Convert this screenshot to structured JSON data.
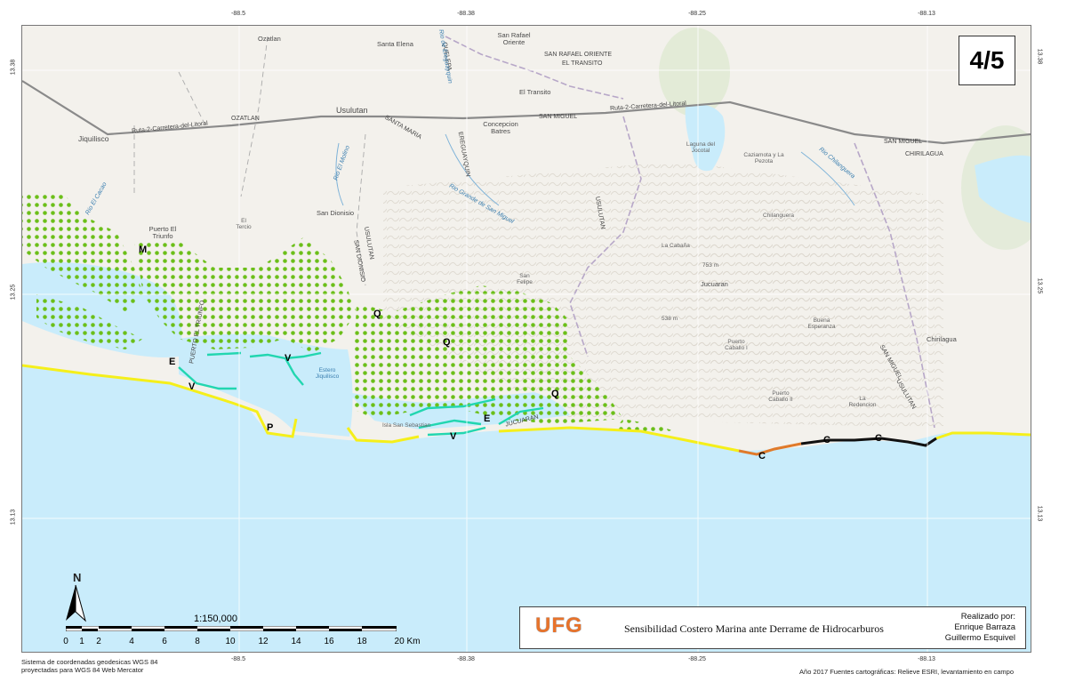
{
  "page_number": "4/5",
  "coordinates": {
    "top": [
      "-88.5",
      "-88.38",
      "-88.25",
      "-88.13"
    ],
    "bottom": [
      "-88.5",
      "-88.38",
      "-88.25",
      "-88.13"
    ],
    "left": [
      "13.38",
      "13.25",
      "13.13"
    ],
    "right": [
      "13.38",
      "13.25",
      "13.13"
    ]
  },
  "places": [
    {
      "name": "Ozatlan"
    },
    {
      "name": "Santa Elena"
    },
    {
      "name": "San Rafael Oriente"
    },
    {
      "name": "El Transito"
    },
    {
      "name": "Usulutan"
    },
    {
      "name": "Jiquilisco"
    },
    {
      "name": "Concepcion Batres"
    },
    {
      "name": "Laguna del Jocotal"
    },
    {
      "name": "Caziamota y La Pezota"
    },
    {
      "name": "Puerto El Triunfo"
    },
    {
      "name": "San Dionisio"
    },
    {
      "name": "El Tercio"
    },
    {
      "name": "Chilanguera"
    },
    {
      "name": "La Cabaña"
    },
    {
      "name": "Jucuaran"
    },
    {
      "name": "San Felipe"
    },
    {
      "name": "Buena Esperanza"
    },
    {
      "name": "Chirilagua"
    },
    {
      "name": "Puerto Caballo I"
    },
    {
      "name": "Puerto Caballo II"
    },
    {
      "name": "La Redencion"
    },
    {
      "name": "Estero Jiquilisco"
    },
    {
      "name": "Isla San Sebastian"
    },
    {
      "name": "753 m"
    },
    {
      "name": "538 m"
    }
  ],
  "roads": [
    {
      "name": "Ruta-2-Carretera-del-Litoral"
    },
    {
      "name": "Ruta-2-Carretera-del-Litoral"
    },
    {
      "name": "SAN RAFAEL ORIENTE"
    },
    {
      "name": "EL TRANSITO"
    },
    {
      "name": "OZATLAN"
    },
    {
      "name": "SANTA MARIA"
    },
    {
      "name": "SAN MIGUEL"
    },
    {
      "name": "SAN MIGUEL"
    },
    {
      "name": "CHIRILAGUA"
    },
    {
      "name": "USULUTAN"
    },
    {
      "name": "USULUTAN"
    },
    {
      "name": "SAN DIONISIO"
    },
    {
      "name": "QUELEPA"
    },
    {
      "name": "PUERTO EL TRIUNFO"
    },
    {
      "name": "USULUTAN"
    },
    {
      "name": "SAN MIGUEL"
    },
    {
      "name": "EREGUAYQUIN"
    },
    {
      "name": "JUCUARAN"
    }
  ],
  "rivers": [
    {
      "name": "Rio El Molino"
    },
    {
      "name": "Rio Grande de San Miguel"
    },
    {
      "name": "Rio Chilanguera"
    },
    {
      "name": "Rio El Cacao"
    },
    {
      "name": "Rio de Ereguayquin"
    }
  ],
  "shore_codes": [
    {
      "code": "M"
    },
    {
      "code": "E"
    },
    {
      "code": "V"
    },
    {
      "code": "V"
    },
    {
      "code": "P"
    },
    {
      "code": "Q"
    },
    {
      "code": "Q"
    },
    {
      "code": "Q"
    },
    {
      "code": "E"
    },
    {
      "code": "V"
    },
    {
      "code": "C"
    },
    {
      "code": "C"
    },
    {
      "code": "C"
    }
  ],
  "north_label": "N",
  "scale": {
    "ratio": "1:150,000",
    "ticks": [
      "0",
      "1",
      "2",
      "4",
      "6",
      "8",
      "10",
      "12",
      "14",
      "16",
      "18",
      "20 Km"
    ]
  },
  "title_block": {
    "logo": "UFG",
    "title": "Sensibilidad Costero Marina ante Derrame de Hidrocarburos",
    "credit_heading": "Realizado por:",
    "author1": "Enrique Barraza",
    "author2": "Guillermo Esquivel"
  },
  "footer": {
    "left_line1": "Sistema de coordenadas geodesicas WGS 84",
    "left_line2": "proyectadas para WGS 84 Web Mercator",
    "right": "Año 2017 Fuentes cartográficas: Relieve ESRI, levantamiento en campo"
  },
  "colors": {
    "sea": "#c9ecfb",
    "land": "#f3f1ec",
    "mangrove_dots": "#6cbf1a",
    "shoreline_sand": "#f5ef1a",
    "shoreline_vegetation": "#22d6b0",
    "shoreline_rock": "#111111",
    "shoreline_mixed": "#e07a2a"
  }
}
